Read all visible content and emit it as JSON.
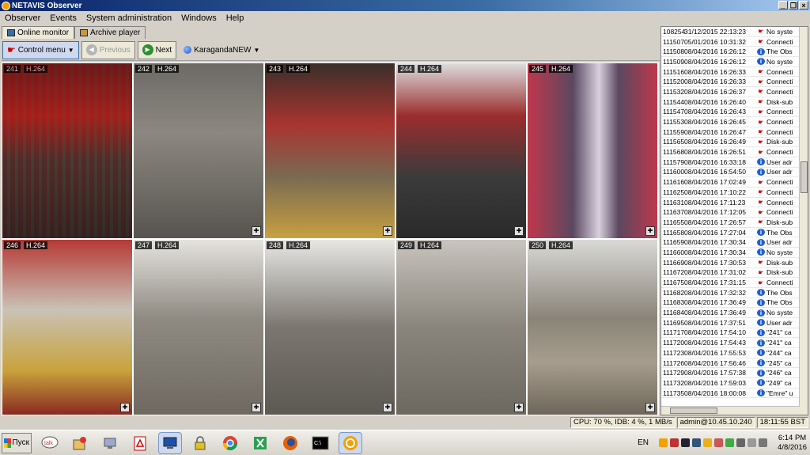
{
  "window": {
    "title": "NETAVIS Observer"
  },
  "menu": [
    "Observer",
    "Events",
    "System administration",
    "Windows",
    "Help"
  ],
  "tabs": [
    {
      "label": "Online monitor",
      "active": true
    },
    {
      "label": "Archive player",
      "active": false
    }
  ],
  "toolbar": {
    "control_menu": "Control menu",
    "previous": "Previous",
    "next": "Next",
    "site": "KaragandaNEW"
  },
  "cameras": [
    {
      "num": "241",
      "codec": "H.264"
    },
    {
      "num": "242",
      "codec": "H.264"
    },
    {
      "num": "243",
      "codec": "H.264"
    },
    {
      "num": "244",
      "codec": "H.264"
    },
    {
      "num": "245",
      "codec": "H.264"
    },
    {
      "num": "246",
      "codec": "H.264"
    },
    {
      "num": "247",
      "codec": "H.264"
    },
    {
      "num": "248",
      "codec": "H.264"
    },
    {
      "num": "249",
      "codec": "H.264"
    },
    {
      "num": "250",
      "codec": "H.264"
    }
  ],
  "events": [
    {
      "id": "108254",
      "dt": "31/12/2015 22:13:23",
      "icon": "warn",
      "msg": "No syste"
    },
    {
      "id": "111507",
      "dt": "05/01/2016 10:31:32",
      "icon": "warn",
      "msg": "Connecti"
    },
    {
      "id": "111508",
      "dt": "08/04/2016 16:26:12",
      "icon": "info",
      "msg": "The Obs"
    },
    {
      "id": "111509",
      "dt": "08/04/2016 16:26:12",
      "icon": "info",
      "msg": "No syste"
    },
    {
      "id": "111516",
      "dt": "08/04/2016 16:26:33",
      "icon": "warn",
      "msg": "Connecti"
    },
    {
      "id": "111520",
      "dt": "08/04/2016 16:26:33",
      "icon": "warn",
      "msg": "Connecti"
    },
    {
      "id": "111532",
      "dt": "08/04/2016 16:26:37",
      "icon": "warn",
      "msg": "Connecti"
    },
    {
      "id": "111544",
      "dt": "08/04/2016 16:26:40",
      "icon": "warn",
      "msg": "Disk-sub"
    },
    {
      "id": "111547",
      "dt": "08/04/2016 16:26:43",
      "icon": "warn",
      "msg": "Connecti"
    },
    {
      "id": "111553",
      "dt": "08/04/2016 16:26:45",
      "icon": "warn",
      "msg": "Connecti"
    },
    {
      "id": "111559",
      "dt": "08/04/2016 16:26:47",
      "icon": "warn",
      "msg": "Connecti"
    },
    {
      "id": "111565",
      "dt": "08/04/2016 16:26:49",
      "icon": "warn",
      "msg": "Disk-sub"
    },
    {
      "id": "111568",
      "dt": "08/04/2016 16:26:51",
      "icon": "warn",
      "msg": "Connecti"
    },
    {
      "id": "111579",
      "dt": "08/04/2016 16:33:18",
      "icon": "info",
      "msg": "User adr"
    },
    {
      "id": "111600",
      "dt": "08/04/2016 16:54:50",
      "icon": "info",
      "msg": "User adr"
    },
    {
      "id": "111616",
      "dt": "08/04/2016 17:02:49",
      "icon": "warn",
      "msg": "Connecti"
    },
    {
      "id": "111625",
      "dt": "08/04/2016 17:10:22",
      "icon": "warn",
      "msg": "Connecti"
    },
    {
      "id": "111631",
      "dt": "08/04/2016 17:11:23",
      "icon": "warn",
      "msg": "Connecti"
    },
    {
      "id": "111637",
      "dt": "08/04/2016 17:12:05",
      "icon": "warn",
      "msg": "Connecti"
    },
    {
      "id": "111655",
      "dt": "08/04/2016 17:26:57",
      "icon": "warn",
      "msg": "Disk-sub"
    },
    {
      "id": "111658",
      "dt": "08/04/2016 17:27:04",
      "icon": "info",
      "msg": "The Obs"
    },
    {
      "id": "111659",
      "dt": "08/04/2016 17:30:34",
      "icon": "info",
      "msg": "User adr"
    },
    {
      "id": "111660",
      "dt": "08/04/2016 17:30:34",
      "icon": "info",
      "msg": "No syste"
    },
    {
      "id": "111669",
      "dt": "08/04/2016 17:30:53",
      "icon": "warn",
      "msg": "Disk-sub"
    },
    {
      "id": "111672",
      "dt": "08/04/2016 17:31:02",
      "icon": "warn",
      "msg": "Disk-sub"
    },
    {
      "id": "111675",
      "dt": "08/04/2016 17:31:15",
      "icon": "warn",
      "msg": "Connecti"
    },
    {
      "id": "111682",
      "dt": "08/04/2016 17:32:32",
      "icon": "info",
      "msg": "The Obs"
    },
    {
      "id": "111683",
      "dt": "08/04/2016 17:36:49",
      "icon": "info",
      "msg": "The Obs"
    },
    {
      "id": "111684",
      "dt": "08/04/2016 17:36:49",
      "icon": "info",
      "msg": "No syste"
    },
    {
      "id": "111695",
      "dt": "08/04/2016 17:37:51",
      "icon": "info",
      "msg": "User adr"
    },
    {
      "id": "111717",
      "dt": "08/04/2016 17:54:10",
      "icon": "info",
      "msg": "\"241\" ca"
    },
    {
      "id": "111720",
      "dt": "08/04/2016 17:54:43",
      "icon": "info",
      "msg": "\"241\" ca"
    },
    {
      "id": "111723",
      "dt": "08/04/2016 17:55:53",
      "icon": "info",
      "msg": "\"244\" ca"
    },
    {
      "id": "111726",
      "dt": "08/04/2016 17:56:46",
      "icon": "info",
      "msg": "\"245\" ca"
    },
    {
      "id": "111729",
      "dt": "08/04/2016 17:57:38",
      "icon": "info",
      "msg": "\"246\" ca"
    },
    {
      "id": "111732",
      "dt": "08/04/2016 17:59:03",
      "icon": "info",
      "msg": "\"249\" ca"
    },
    {
      "id": "111735",
      "dt": "08/04/2016 18:00:08",
      "icon": "info",
      "msg": "\"Emre\" u"
    }
  ],
  "status": {
    "cpu": "CPU: 70 %, IDB: 4 %, 1 MB/s",
    "user": "admin@10.45.10.240",
    "time": "18:11:55 BST"
  },
  "taskbar": {
    "start": "Пуск",
    "lang": "EN",
    "clock_time": "6:14 PM",
    "clock_date": "4/8/2016"
  }
}
